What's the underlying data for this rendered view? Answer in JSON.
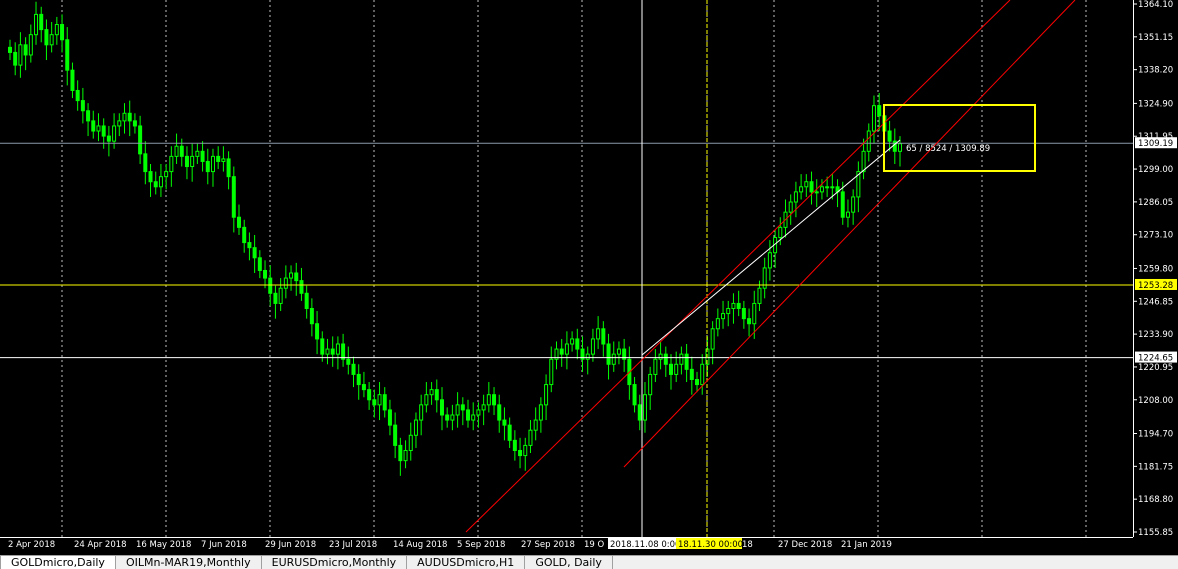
{
  "window": {
    "colors": {
      "background": "#000000",
      "candle": "#00ff00",
      "grid": "#ffffff",
      "channel": "#ff0000",
      "hline_yellow": "#ffff00",
      "hline_white": "#ffffff",
      "price_line": "#8a9aaa",
      "label_highlight": "#ffff00"
    }
  },
  "chart_data": {
    "type": "candlestick",
    "symbol": "GOLDmicro",
    "timeframe": "Daily",
    "y_ticks": [
      "1364.10",
      "1351.15",
      "1338.20",
      "1324.90",
      "1311.95",
      "1299.00",
      "1286.05",
      "1273.10",
      "1259.80",
      "1246.85",
      "1233.90",
      "1220.95",
      "1208.00",
      "1194.70",
      "1181.75",
      "1168.80",
      "1155.85"
    ],
    "ylim": [
      1155.85,
      1364.1
    ],
    "x_ticks": [
      "2 Apr 2018",
      "24 Apr 2018",
      "16 May 2018",
      "7 Jun 2018",
      "29 Jun 2018",
      "23 Jul 2018",
      "14 Aug 2018",
      "5 Sep 2018",
      "27 Sep 2018",
      "19 O",
      "2018.11.08 0:00",
      "18.11.30 00:00",
      "18",
      "27 Dec 2018",
      "21 Jan 2019"
    ],
    "price_labels": {
      "current": "1309.19",
      "yellow_line": "1253.28",
      "white_line": "1224.65"
    },
    "annotation": "65 / 8524 / 1309.89",
    "close_series": [
      1345,
      1340,
      1348,
      1344,
      1352,
      1360,
      1354,
      1348,
      1352,
      1356,
      1350,
      1338,
      1330,
      1326,
      1322,
      1318,
      1314,
      1316,
      1312,
      1310,
      1316,
      1318,
      1321,
      1318,
      1316,
      1305,
      1298,
      1294,
      1292,
      1296,
      1298,
      1304,
      1308,
      1304,
      1300,
      1304,
      1306,
      1302,
      1298,
      1304,
      1302,
      1303,
      1296,
      1280,
      1276,
      1270,
      1268,
      1264,
      1259,
      1256,
      1250,
      1246,
      1252,
      1256,
      1258,
      1255,
      1250,
      1244,
      1238,
      1232,
      1226,
      1228,
      1226,
      1230,
      1224,
      1222,
      1218,
      1214,
      1212,
      1208,
      1206,
      1210,
      1204,
      1198,
      1190,
      1184,
      1188,
      1194,
      1200,
      1206,
      1210,
      1212,
      1208,
      1202,
      1200,
      1202,
      1206,
      1204,
      1200,
      1202,
      1204,
      1206,
      1210,
      1206,
      1200,
      1198,
      1192,
      1188,
      1186,
      1190,
      1196,
      1200,
      1206,
      1214,
      1224,
      1228,
      1226,
      1230,
      1232,
      1228,
      1224,
      1226,
      1232,
      1236,
      1230,
      1222,
      1226,
      1228,
      1224,
      1214,
      1206,
      1200,
      1210,
      1218,
      1224,
      1226,
      1222,
      1218,
      1222,
      1226,
      1220,
      1216,
      1214,
      1222,
      1228,
      1236,
      1240,
      1242,
      1244,
      1246,
      1244,
      1240,
      1238,
      1246,
      1252,
      1260,
      1266,
      1272,
      1276,
      1282,
      1286,
      1290,
      1292,
      1294,
      1290,
      1290,
      1292,
      1292,
      1292,
      1290,
      1280,
      1282,
      1288,
      1298,
      1306,
      1314,
      1324,
      1320,
      1314,
      1310,
      1306,
      1309
    ]
  },
  "tabs": [
    {
      "label": "GOLDmicro,Daily",
      "active": true
    },
    {
      "label": "OILMn-MAR19,Monthly",
      "active": false
    },
    {
      "label": "EURUSDmicro,Monthly",
      "active": false
    },
    {
      "label": "AUDUSDmicro,H1",
      "active": false
    },
    {
      "label": "GOLD, Daily",
      "active": false
    }
  ]
}
